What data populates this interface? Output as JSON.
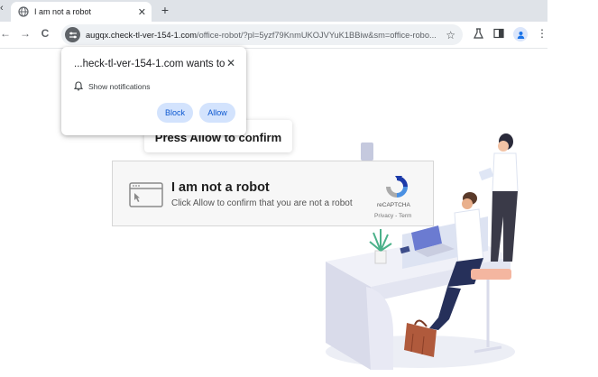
{
  "browser": {
    "tab": {
      "title": "I am not a robot",
      "close_glyph": "✕"
    },
    "new_tab_glyph": "+",
    "nav": {
      "back_glyph": "←",
      "forward_glyph": "→",
      "reload_glyph": "C"
    },
    "address": {
      "host": "augqx.check-tl-ver-154-1.com",
      "path": "/office-robot/?pl=5yzf79KnmUKOJVYuK1BBiw&sm=office-robo..."
    }
  },
  "permission_prompt": {
    "host_text": "...heck-tl-ver-154-1.com wants to",
    "close_glyph": "✕",
    "permission_label": "Show notifications",
    "block_label": "Block",
    "allow_label": "Allow"
  },
  "page": {
    "press_allow_text": "Press Allow to confirm",
    "captcha": {
      "heading": "I am not a robot",
      "subtext": "Click Allow to confirm that you are not a robot",
      "brand": "reCAPTCHA",
      "links": "Privacy - Term"
    }
  },
  "colors": {
    "accent": "#0b57d0",
    "button_bg": "#d3e3fd",
    "tabstrip": "#dfe3e8"
  }
}
